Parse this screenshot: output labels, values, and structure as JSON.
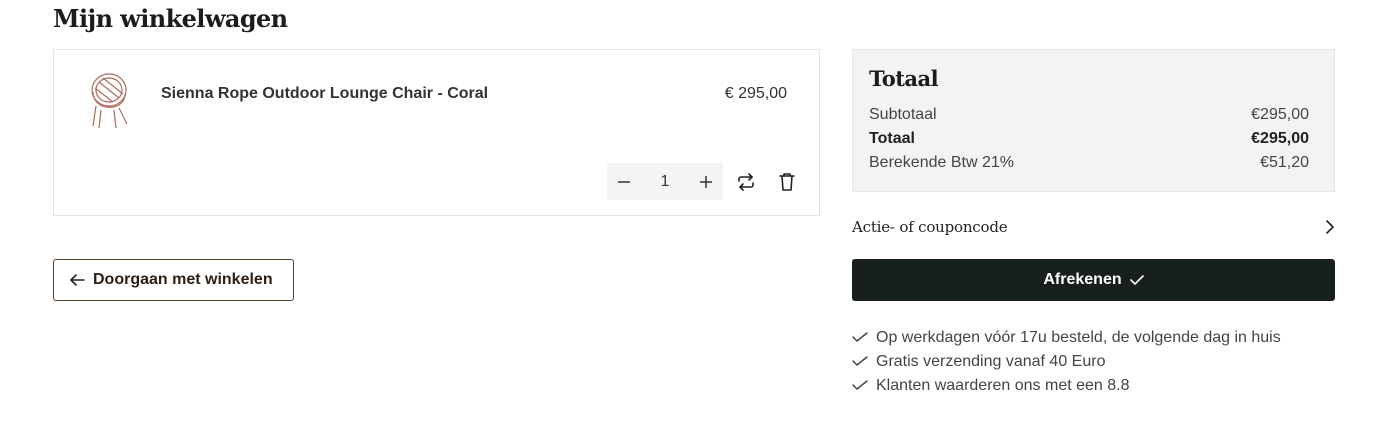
{
  "page": {
    "title": "Mijn winkelwagen"
  },
  "cart": {
    "items": [
      {
        "name": "Sienna Rope Outdoor Lounge Chair - Coral",
        "price": "€ 295,00",
        "quantity": "1",
        "thumbnail_color": "#b06a5a"
      }
    ]
  },
  "actions": {
    "continue_label": "Doorgaan met winkelen",
    "checkout_label": "Afrekenen",
    "coupon_label": "Actie- of couponcode"
  },
  "summary": {
    "title": "Totaal",
    "subtotal_label": "Subtotaal",
    "subtotal_value": "€295,00",
    "total_label": "Totaal",
    "total_value": "€295,00",
    "vat_label": "Berekende Btw 21%",
    "vat_value": "€51,20"
  },
  "usps": [
    "Op werkdagen vóór 17u besteld, de volgende dag in huis",
    "Gratis verzending vanaf 40 Euro",
    "Klanten waarderen ons met een 8.8"
  ],
  "colors": {
    "checkout_bg": "#17201b",
    "continue_border": "#5a3b26",
    "summary_bg": "#f3f3f3"
  }
}
